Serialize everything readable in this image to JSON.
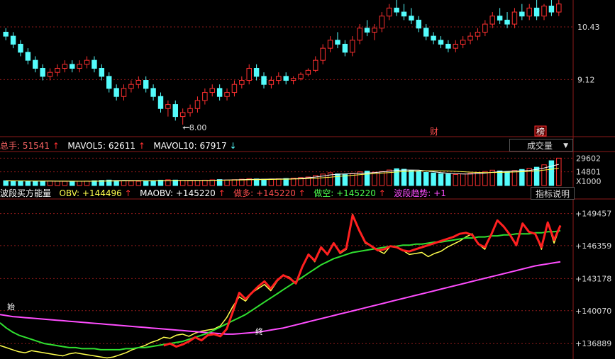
{
  "price_panel": {
    "axis_labels": [
      "10.43",
      "9.12"
    ],
    "low_marker": "8.00",
    "event_markers": [
      "财",
      "榜"
    ]
  },
  "volume_panel": {
    "stats": [
      {
        "label": "总手:",
        "value": "51541",
        "arrow": "↑",
        "color": "#ff4d4d"
      },
      {
        "label": "MAVOL5:",
        "value": "62611",
        "arrow": "↑",
        "color": "#ffffff"
      },
      {
        "label": "MAVOL10:",
        "value": "67917",
        "arrow": "↓",
        "color": "#ffff4d"
      }
    ],
    "dropdown_label": "成交量",
    "axis_labels": [
      "29602",
      "14801",
      "X1000"
    ]
  },
  "indicator_panel": {
    "title": "波段买方能量",
    "stats": [
      {
        "label": "OBV:",
        "value": "+144496",
        "arrow": "↑",
        "color": "#ffff4d"
      },
      {
        "label": "MAOBV:",
        "value": "+145220",
        "arrow": "↑",
        "color": "#ff4dff"
      },
      {
        "label": "做多:",
        "value": "+145220",
        "arrow": "↑",
        "color": "#ff4d4d"
      },
      {
        "label": "做空:",
        "value": "+145220",
        "arrow": "↑",
        "color": "#4dff4d"
      },
      {
        "label": "波段趋势:",
        "value": "+1",
        "arrow": "",
        "color": "#ff4dff"
      }
    ],
    "help_button": "指标说明",
    "axis_labels": [
      "149457",
      "146359",
      "143178",
      "140070",
      "136889"
    ],
    "signal_markers": [
      "始",
      "终"
    ]
  },
  "colors": {
    "up": "#ff3030",
    "down": "#54fcfc",
    "obv": "#ffff4d",
    "maobv": "#ff4dff",
    "long": "#ff2020",
    "short": "#30e030",
    "grid": "#8b1a1a"
  },
  "chart_data": [
    {
      "type": "candlestick",
      "title": "",
      "ylim": [
        7.7,
        11.1
      ],
      "ticks": [
        10.43,
        9.12
      ],
      "low_annotation": 8.0,
      "candles": [
        [
          10.3,
          10.4,
          10.1,
          10.2
        ],
        [
          10.2,
          10.3,
          9.9,
          10.0
        ],
        [
          10.0,
          10.1,
          9.7,
          9.8
        ],
        [
          9.8,
          9.9,
          9.5,
          9.6
        ],
        [
          9.6,
          9.7,
          9.3,
          9.4
        ],
        [
          9.4,
          9.5,
          9.1,
          9.2
        ],
        [
          9.2,
          9.4,
          9.1,
          9.3
        ],
        [
          9.3,
          9.5,
          9.2,
          9.4
        ],
        [
          9.4,
          9.6,
          9.3,
          9.5
        ],
        [
          9.5,
          9.6,
          9.3,
          9.4
        ],
        [
          9.4,
          9.6,
          9.3,
          9.5
        ],
        [
          9.5,
          9.7,
          9.4,
          9.6
        ],
        [
          9.6,
          9.7,
          9.3,
          9.4
        ],
        [
          9.4,
          9.5,
          9.1,
          9.2
        ],
        [
          9.2,
          9.3,
          8.8,
          8.9
        ],
        [
          8.9,
          9.0,
          8.6,
          8.7
        ],
        [
          8.7,
          9.0,
          8.6,
          8.9
        ],
        [
          8.9,
          9.1,
          8.8,
          9.0
        ],
        [
          9.0,
          9.2,
          8.9,
          9.1
        ],
        [
          9.1,
          9.2,
          8.8,
          8.9
        ],
        [
          8.9,
          9.0,
          8.6,
          8.7
        ],
        [
          8.7,
          8.8,
          8.3,
          8.4
        ],
        [
          8.4,
          8.6,
          8.2,
          8.5
        ],
        [
          8.5,
          8.6,
          8.1,
          8.2
        ],
        [
          8.2,
          8.4,
          8.0,
          8.3
        ],
        [
          8.3,
          8.5,
          8.2,
          8.4
        ],
        [
          8.4,
          8.7,
          8.3,
          8.6
        ],
        [
          8.6,
          8.9,
          8.5,
          8.8
        ],
        [
          8.8,
          9.0,
          8.7,
          8.9
        ],
        [
          8.9,
          9.0,
          8.6,
          8.7
        ],
        [
          8.7,
          8.9,
          8.6,
          8.8
        ],
        [
          8.8,
          9.1,
          8.7,
          9.0
        ],
        [
          9.0,
          9.2,
          8.9,
          9.1
        ],
        [
          9.1,
          9.5,
          9.0,
          9.4
        ],
        [
          9.4,
          9.5,
          9.1,
          9.2
        ],
        [
          9.2,
          9.3,
          8.9,
          9.0
        ],
        [
          9.0,
          9.2,
          8.9,
          9.1
        ],
        [
          9.1,
          9.3,
          9.0,
          9.2
        ],
        [
          9.2,
          9.3,
          9.0,
          9.1
        ],
        [
          9.1,
          9.2,
          9.0,
          9.15
        ],
        [
          9.15,
          9.3,
          9.1,
          9.25
        ],
        [
          9.25,
          9.4,
          9.2,
          9.35
        ],
        [
          9.35,
          9.7,
          9.3,
          9.6
        ],
        [
          9.6,
          10.0,
          9.5,
          9.9
        ],
        [
          9.9,
          10.2,
          9.8,
          10.1
        ],
        [
          10.1,
          10.3,
          9.9,
          10.0
        ],
        [
          10.0,
          10.1,
          9.7,
          9.8
        ],
        [
          9.8,
          10.2,
          9.7,
          10.1
        ],
        [
          10.1,
          10.5,
          10.0,
          10.4
        ],
        [
          10.4,
          10.6,
          10.2,
          10.3
        ],
        [
          10.3,
          10.5,
          10.1,
          10.4
        ],
        [
          10.4,
          10.8,
          10.3,
          10.7
        ],
        [
          10.7,
          11.0,
          10.6,
          10.9
        ],
        [
          10.9,
          11.1,
          10.7,
          10.8
        ],
        [
          10.8,
          11.0,
          10.6,
          10.7
        ],
        [
          10.7,
          10.9,
          10.5,
          10.6
        ],
        [
          10.6,
          10.7,
          10.3,
          10.4
        ],
        [
          10.4,
          10.5,
          10.1,
          10.2
        ],
        [
          10.2,
          10.3,
          10.0,
          10.1
        ],
        [
          10.1,
          10.2,
          9.9,
          10.0
        ],
        [
          10.0,
          10.1,
          9.8,
          9.9
        ],
        [
          9.9,
          10.1,
          9.8,
          10.0
        ],
        [
          10.0,
          10.2,
          9.9,
          10.1
        ],
        [
          10.1,
          10.3,
          10.0,
          10.2
        ],
        [
          10.2,
          10.4,
          10.1,
          10.3
        ],
        [
          10.3,
          10.6,
          10.2,
          10.5
        ],
        [
          10.5,
          10.8,
          10.4,
          10.7
        ],
        [
          10.7,
          10.9,
          10.5,
          10.6
        ],
        [
          10.6,
          10.8,
          10.4,
          10.5
        ],
        [
          10.5,
          10.9,
          10.4,
          10.8
        ],
        [
          10.8,
          11.0,
          10.6,
          10.7
        ],
        [
          10.7,
          11.0,
          10.6,
          10.9
        ],
        [
          10.9,
          11.1,
          10.6,
          10.7
        ],
        [
          10.7,
          11.0,
          10.6,
          10.95
        ],
        [
          10.95,
          11.1,
          10.7,
          10.8
        ],
        [
          10.8,
          11.1,
          10.7,
          11.0
        ]
      ]
    },
    {
      "type": "bar",
      "title": "",
      "ylim": [
        0,
        36000
      ],
      "ticks": [
        29602,
        14801
      ],
      "unit": "X1000",
      "values": [
        5200,
        4800,
        5100,
        4600,
        4400,
        4900,
        5000,
        4700,
        4500,
        4300,
        4600,
        4800,
        5200,
        5600,
        5900,
        5400,
        5100,
        4800,
        4600,
        5000,
        5300,
        5800,
        6200,
        5900,
        5500,
        5200,
        5400,
        5800,
        6100,
        6400,
        6000,
        6300,
        6800,
        7400,
        7100,
        6800,
        7000,
        7300,
        7600,
        8000,
        8600,
        9200,
        10800,
        12400,
        13800,
        12600,
        11800,
        13200,
        14800,
        15600,
        14400,
        15200,
        16800,
        18200,
        17600,
        16200,
        15400,
        14200,
        13600,
        12800,
        12400,
        11900,
        12600,
        13300,
        14100,
        15200,
        16600,
        15800,
        14900,
        16200,
        17400,
        18600,
        19800,
        22400,
        26800,
        29602
      ],
      "ma5": [
        5000,
        5000,
        5000,
        4900,
        4800,
        4800,
        4800,
        4700,
        4700,
        4600,
        4600,
        4600,
        4700,
        4900,
        5200,
        5300,
        5400,
        5400,
        5400,
        5200,
        5100,
        5100,
        5300,
        5500,
        5600,
        5700,
        5700,
        5600,
        5700,
        5900,
        6000,
        6100,
        6300,
        6600,
        6700,
        6800,
        7000,
        7100,
        7200,
        7300,
        7800,
        8400,
        9200,
        10300,
        11500,
        12200,
        12600,
        12900,
        13300,
        13600,
        14000,
        14800,
        15400,
        16400,
        16800,
        16800,
        16600,
        15800,
        14900,
        14000,
        13300,
        12800,
        12500,
        12500,
        12900,
        13400,
        14300,
        14900,
        15300,
        15700,
        16000,
        16400,
        17400,
        19000,
        21000,
        22900
      ],
      "ma10": [
        5100,
        5100,
        5000,
        5000,
        4900,
        4900,
        4900,
        4800,
        4800,
        4800,
        4700,
        4700,
        4700,
        4700,
        4800,
        4900,
        5000,
        5100,
        5100,
        5100,
        5200,
        5300,
        5300,
        5400,
        5400,
        5400,
        5400,
        5400,
        5500,
        5700,
        5800,
        5900,
        6000,
        6200,
        6300,
        6400,
        6500,
        6700,
        6800,
        7000,
        7200,
        7500,
        7900,
        8400,
        9000,
        9700,
        10400,
        11000,
        11700,
        12300,
        12900,
        13500,
        14000,
        14600,
        15100,
        15500,
        15700,
        15900,
        16000,
        15900,
        15700,
        15300,
        14900,
        14500,
        14200,
        14000,
        14100,
        14200,
        14400,
        14600,
        14900,
        15300,
        15900,
        16700,
        17600,
        18800
      ]
    },
    {
      "type": "line",
      "title": "波段买方能量",
      "ylim": [
        135400,
        150800
      ],
      "ticks": [
        149457,
        146359,
        143178,
        140070,
        136889
      ],
      "series": [
        {
          "name": "OBV",
          "values": [
            136700,
            136500,
            136300,
            136100,
            136000,
            136200,
            136100,
            136000,
            135900,
            135800,
            135700,
            135900,
            136000,
            135900,
            135800,
            135700,
            135600,
            135500,
            135600,
            135800,
            136000,
            136300,
            136500,
            136700,
            137000,
            137200,
            137500,
            137400,
            137700,
            137800,
            137600,
            137900,
            138100,
            138200,
            138300,
            138600,
            139400,
            140500,
            141400,
            141000,
            141800,
            142200,
            142600,
            142000,
            142900,
            143500,
            143300,
            142700,
            144300,
            145500,
            144800,
            146100,
            145500,
            146600,
            145600,
            146000,
            149400,
            147800,
            146600,
            146300,
            145900,
            145600,
            146300,
            146200,
            145900,
            145500,
            145600,
            145700,
            145300,
            145600,
            145800,
            146200,
            146500,
            146800,
            147200,
            147500,
            146500,
            146000,
            147400,
            148800,
            148200,
            147400,
            146400,
            148500,
            147700,
            147500,
            146000,
            148600,
            146600,
            148300
          ]
        },
        {
          "name": "MAOBV",
          "values": [
            139700,
            139600,
            139500,
            139450,
            139400,
            139350,
            139300,
            139250,
            139200,
            139150,
            139100,
            139050,
            139000,
            138950,
            138900,
            138850,
            138800,
            138750,
            138700,
            138650,
            138600,
            138550,
            138500,
            138450,
            138400,
            138350,
            138300,
            138250,
            138200,
            138150,
            138100,
            138050,
            138000,
            137950,
            137900,
            137850,
            137800,
            137800,
            137850,
            137900,
            137950,
            138000,
            138100,
            138200,
            138300,
            138400,
            138550,
            138700,
            138850,
            139000,
            139150,
            139300,
            139450,
            139600,
            139750,
            139900,
            140050,
            140200,
            140350,
            140500,
            140650,
            140800,
            140950,
            141100,
            141250,
            141400,
            141550,
            141700,
            141850,
            142000,
            142150,
            142300,
            142450,
            142600,
            142750,
            142900,
            143050,
            143200,
            143350,
            143500,
            143650,
            143800,
            143950,
            144100,
            144250,
            144400,
            144500,
            144600,
            144700,
            144800
          ]
        },
        {
          "name": "做多",
          "values": [
            null,
            null,
            null,
            null,
            null,
            null,
            null,
            null,
            null,
            null,
            null,
            null,
            null,
            null,
            null,
            null,
            null,
            null,
            null,
            null,
            null,
            null,
            null,
            null,
            null,
            null,
            136700,
            136900,
            136600,
            136800,
            137100,
            137500,
            137200,
            137700,
            137800,
            137600,
            138300,
            140000,
            141800,
            141200,
            141800,
            142400,
            142900,
            142200,
            143000,
            143500,
            143200,
            142700,
            144300,
            145500,
            144900,
            146200,
            145500,
            146600,
            145700,
            146100,
            149300,
            147900,
            146700,
            146300,
            145900,
            146000,
            146300,
            146200,
            145900,
            145800,
            146000,
            146200,
            146400,
            146600,
            146800,
            147000,
            147200,
            147500,
            147600,
            147400,
            146500,
            146200,
            147400,
            148800,
            148200,
            147400,
            146400,
            148500,
            147700,
            147500,
            146200,
            148600,
            146900,
            148300
          ]
        },
        {
          "name": "做空",
          "values": [
            138900,
            138400,
            138000,
            137700,
            137500,
            137300,
            137100,
            136900,
            136800,
            136700,
            136600,
            136500,
            136500,
            136400,
            136400,
            136400,
            136300,
            136300,
            136300,
            136300,
            136400,
            136400,
            136500,
            136500,
            136600,
            136700,
            136800,
            136900,
            137000,
            137100,
            137300,
            137500,
            137700,
            137900,
            138200,
            138500,
            138800,
            139100,
            139400,
            139700,
            140100,
            140500,
            140900,
            141300,
            141700,
            142100,
            142500,
            142900,
            143300,
            143700,
            144100,
            144500,
            144800,
            145100,
            145300,
            145500,
            145700,
            145800,
            145900,
            146000,
            146100,
            146200,
            146300,
            146300,
            146400,
            146400,
            146500,
            146500,
            146600,
            146700,
            146700,
            146800,
            146900,
            147000,
            147100,
            147100,
            147200,
            147200,
            147300,
            147300,
            147400,
            147400,
            147500,
            147500,
            147500,
            147600,
            147600,
            147700,
            147700,
            147800
          ]
        }
      ]
    }
  ]
}
